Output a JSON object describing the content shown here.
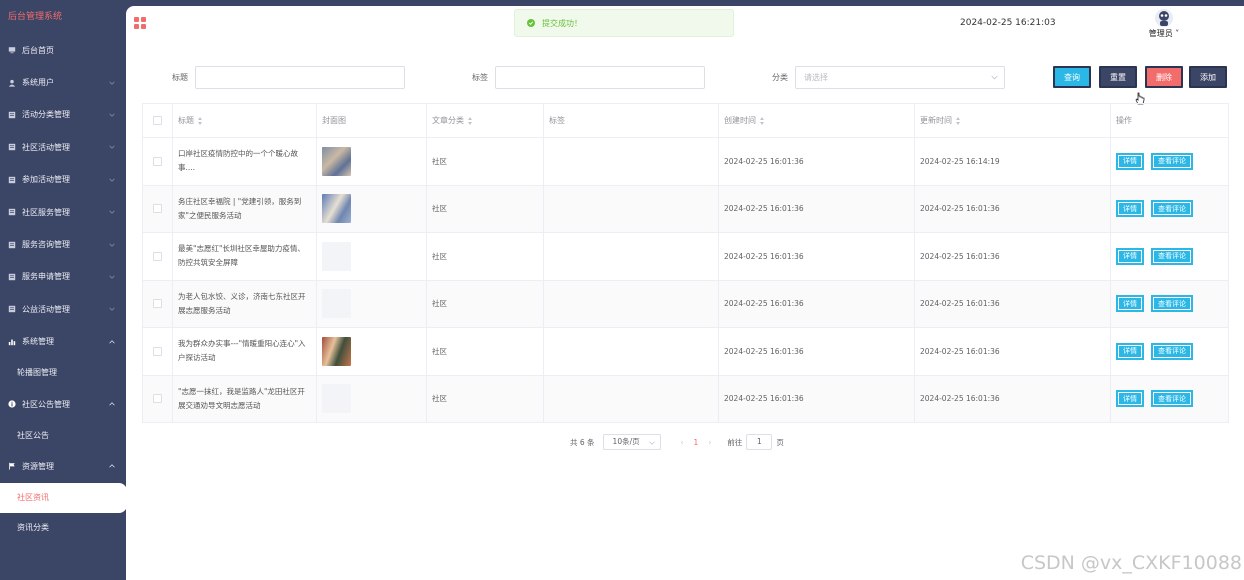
{
  "app": {
    "title": "后台管理系统"
  },
  "sidebar": {
    "items": [
      {
        "label": "后台首页",
        "icon": "monitor-icon",
        "expandable": false
      },
      {
        "label": "系统用户",
        "icon": "user-icon",
        "expandable": true
      },
      {
        "label": "活动分类管理",
        "icon": "list-icon",
        "expandable": true
      },
      {
        "label": "社区活动管理",
        "icon": "list-icon",
        "expandable": true
      },
      {
        "label": "参加活动管理",
        "icon": "list-icon",
        "expandable": true
      },
      {
        "label": "社区服务管理",
        "icon": "list-icon",
        "expandable": true
      },
      {
        "label": "服务咨询管理",
        "icon": "list-icon",
        "expandable": true
      },
      {
        "label": "服务申请管理",
        "icon": "list-icon",
        "expandable": true
      },
      {
        "label": "公益活动管理",
        "icon": "list-icon",
        "expandable": true
      }
    ],
    "system": {
      "label": "系统管理",
      "icon": "bar-chart-icon",
      "sub": [
        "轮播图管理"
      ]
    },
    "notice": {
      "label": "社区公告管理",
      "icon": "info-icon",
      "sub": [
        "社区公告"
      ]
    },
    "resource": {
      "label": "资源管理",
      "icon": "flag-icon",
      "sub": [
        "社区资讯",
        "资讯分类"
      ]
    }
  },
  "header": {
    "toast": "提交成功！",
    "datetime": "2024-02-25 16:21:03",
    "user": "管理员"
  },
  "search": {
    "title_label": "标题",
    "tag_label": "标签",
    "category_label": "分类",
    "category_placeholder": "请选择",
    "buttons": {
      "query": "查询",
      "reset": "重置",
      "delete": "删除",
      "add": "添加"
    }
  },
  "table": {
    "headers": {
      "title": "标题",
      "cover": "封面图",
      "category": "文章分类",
      "tag": "标签",
      "created": "创建时间",
      "updated": "更新时间",
      "actions": "操作"
    },
    "rows": [
      {
        "title": "口岸社区疫情防控中的一个个暖心故事....",
        "cover": "photo1",
        "category": "社区",
        "tag": "",
        "created": "2024-02-25 16:01:36",
        "updated": "2024-02-25 16:14:19"
      },
      {
        "title": "务庄社区幸福院 | \"党建引领，服务到家\"之便民服务活动",
        "cover": "photo2",
        "category": "社区",
        "tag": "",
        "created": "2024-02-25 16:01:36",
        "updated": "2024-02-25 16:01:36"
      },
      {
        "title": "最美\"志愿红\"长圳社区幸屋助力疫情、防控共筑安全屏障",
        "cover": "blank",
        "category": "社区",
        "tag": "",
        "created": "2024-02-25 16:01:36",
        "updated": "2024-02-25 16:01:36"
      },
      {
        "title": "为老人包水饺、义诊，济南七东社区开展志愿服务活动",
        "cover": "blank",
        "category": "社区",
        "tag": "",
        "created": "2024-02-25 16:01:36",
        "updated": "2024-02-25 16:01:36"
      },
      {
        "title": "我为群众办实事---\"情暖重阳心连心\"入户探访活动",
        "cover": "photo3",
        "category": "社区",
        "tag": "",
        "created": "2024-02-25 16:01:36",
        "updated": "2024-02-25 16:01:36"
      },
      {
        "title": "\"志愿一抹红，我是监路人\"龙田社区开展交通劝导文明志愿活动",
        "cover": "blank",
        "category": "社区",
        "tag": "",
        "created": "2024-02-25 16:01:36",
        "updated": "2024-02-25 16:01:36"
      }
    ],
    "row_actions": {
      "detail": "详情",
      "comments": "查看评论"
    }
  },
  "pagination": {
    "total": "共 6 条",
    "page_size": "10条/页",
    "current": "1",
    "goto_prefix": "前往",
    "goto_value": "1",
    "goto_suffix": "页"
  },
  "watermark": "CSDN @vx_CXKF10088",
  "colors": {
    "accent": "#f36c6c",
    "primary": "#2cb8e6",
    "sidebar": "#3b4566",
    "success": "#67c23a"
  }
}
